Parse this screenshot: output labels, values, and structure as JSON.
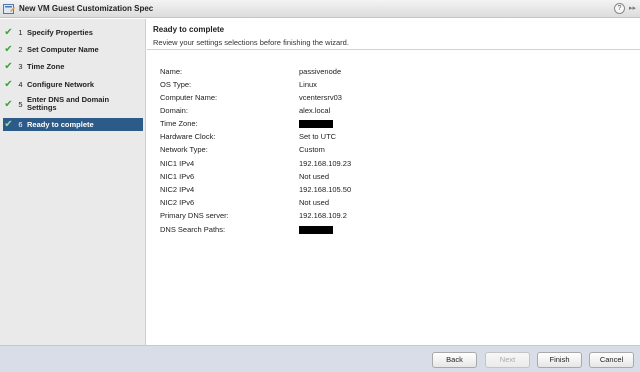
{
  "window": {
    "title": "New VM Guest Customization Spec",
    "help_icon": "?",
    "expand_icon": "▸▸"
  },
  "sidebar": {
    "steps": [
      {
        "num": "1",
        "label": "Specify Properties",
        "done": true,
        "active": false
      },
      {
        "num": "2",
        "label": "Set Computer Name",
        "done": true,
        "active": false
      },
      {
        "num": "3",
        "label": "Time Zone",
        "done": true,
        "active": false
      },
      {
        "num": "4",
        "label": "Configure Network",
        "done": true,
        "active": false
      },
      {
        "num": "5",
        "label": "Enter DNS and Domain Settings",
        "done": true,
        "active": false
      },
      {
        "num": "6",
        "label": "Ready to complete",
        "done": true,
        "active": true
      }
    ]
  },
  "main": {
    "heading": "Ready to complete",
    "subheading": "Review your settings selections before finishing the wizard.",
    "summary": [
      {
        "key": "Name:",
        "value": "passivenode"
      },
      {
        "key": "OS Type:",
        "value": "Linux"
      },
      {
        "key": "Computer Name:",
        "value": "vcentersrv03"
      },
      {
        "key": "Domain:",
        "value": "alex.local"
      },
      {
        "key": "Time Zone:",
        "value": "",
        "redacted": true
      },
      {
        "key": "Hardware Clock:",
        "value": "Set to UTC"
      },
      {
        "key": "Network Type:",
        "value": "Custom"
      },
      {
        "key": "NIC1 IPv4",
        "value": "192.168.109.23"
      },
      {
        "key": "NIC1 IPv6",
        "value": "Not used"
      },
      {
        "key": "NIC2 IPv4",
        "value": "192.168.105.50"
      },
      {
        "key": "NIC2 IPv6",
        "value": "Not used"
      },
      {
        "key": "Primary DNS server:",
        "value": "192.168.109.2"
      },
      {
        "key": "DNS Search Paths:",
        "value": "",
        "redacted": true
      }
    ]
  },
  "footer": {
    "back_label": "Back",
    "next_label": "Next",
    "finish_label": "Finish",
    "cancel_label": "Cancel"
  },
  "colors": {
    "active_step": "#2d5b89",
    "check": "#3aa53a",
    "footer_bg": "#d8dde7"
  }
}
